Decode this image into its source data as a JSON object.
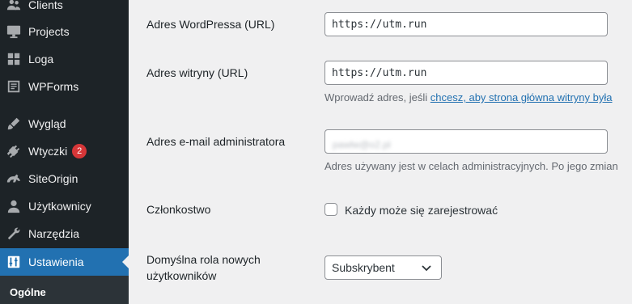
{
  "sidebar": {
    "items": [
      {
        "label": "Clients",
        "icon": "users-icon"
      },
      {
        "label": "Projects",
        "icon": "projects-icon"
      },
      {
        "label": "Loga",
        "icon": "grid-icon"
      },
      {
        "label": "WPForms",
        "icon": "forms-icon"
      },
      {
        "label": "Wygląd",
        "icon": "brush-icon"
      },
      {
        "label": "Wtyczki",
        "icon": "plugin-icon",
        "badge": "2"
      },
      {
        "label": "SiteOrigin",
        "icon": "siteorigin-icon"
      },
      {
        "label": "Użytkownicy",
        "icon": "user-icon"
      },
      {
        "label": "Narzędzia",
        "icon": "wrench-icon"
      },
      {
        "label": "Ustawienia",
        "icon": "settings-icon",
        "active": true
      }
    ],
    "submenu_active": "Ogólne"
  },
  "form": {
    "wp_url_label": "Adres WordPressa (URL)",
    "wp_url_value": "https://utm.run",
    "site_url_label": "Adres witryny (URL)",
    "site_url_value": "https://utm.run",
    "site_url_desc_prefix": "Wprowadź adres, jeśli ",
    "site_url_desc_link": "chcesz, aby strona główna witryny była",
    "admin_email_label": "Adres e-mail administratora",
    "admin_email_value": "pawlw@o2.pl",
    "admin_email_desc": "Adres używany jest w celach administracyjnych. Po jego zmian",
    "membership_label": "Członkostwo",
    "membership_checkbox_label": "Każdy może się zarejestrować",
    "membership_checked": false,
    "default_role_label_line1": "Domyślna rola nowych",
    "default_role_label_line2": "użytkowników",
    "default_role_value": "Subskrybent"
  },
  "colors": {
    "sidebar_bg": "#1d2327",
    "active_bg": "#2271b1",
    "badge_bg": "#d63638",
    "content_bg": "#f0f0f1",
    "link": "#2271b1"
  }
}
